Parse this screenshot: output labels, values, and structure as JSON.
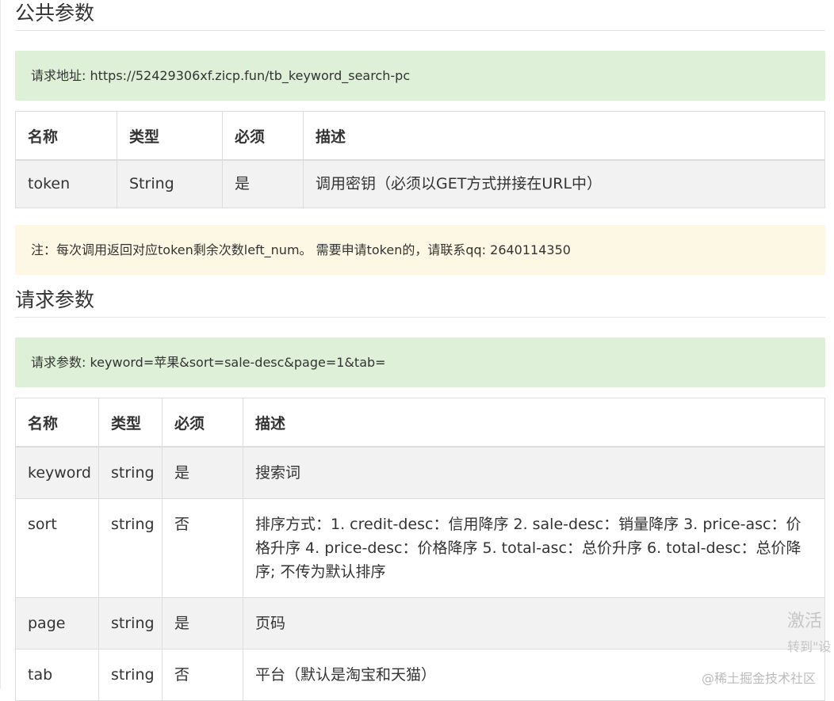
{
  "public_params": {
    "heading": "公共参数",
    "request_address": "请求地址: https://52429306xf.zicp.fun/tb_keyword_search-pc",
    "table": {
      "headers": [
        "名称",
        "类型",
        "必须",
        "描述"
      ],
      "rows": [
        [
          "token",
          "String",
          "是",
          "调用密钥（必须以GET方式拼接在URL中）"
        ]
      ]
    },
    "note": "注：每次调用返回对应token剩余次数left_num。 需要申请token的，请联系qq: 2640114350"
  },
  "request_params": {
    "heading": "请求参数",
    "request_example": "请求参数: keyword=苹果&sort=sale-desc&page=1&tab=",
    "table": {
      "headers": [
        "名称",
        "类型",
        "必须",
        "描述"
      ],
      "rows": [
        [
          "keyword",
          "string",
          "是",
          "搜索词"
        ],
        [
          "sort",
          "string",
          "否",
          "排序方式：1. credit-desc：信用降序 2. sale-desc：销量降序 3. price-asc：价格升序 4. price-desc：价格降序 5. total-asc：总价升序 6. total-desc：总价降序; 不传为默认排序"
        ],
        [
          "page",
          "string",
          "是",
          "页码"
        ],
        [
          "tab",
          "string",
          "否",
          "平台（默认是淘宝和天猫）"
        ]
      ]
    }
  },
  "watermarks": {
    "activate": "激活",
    "goto_settings": "转到\"设",
    "site": "@稀土掘金技术社区"
  }
}
